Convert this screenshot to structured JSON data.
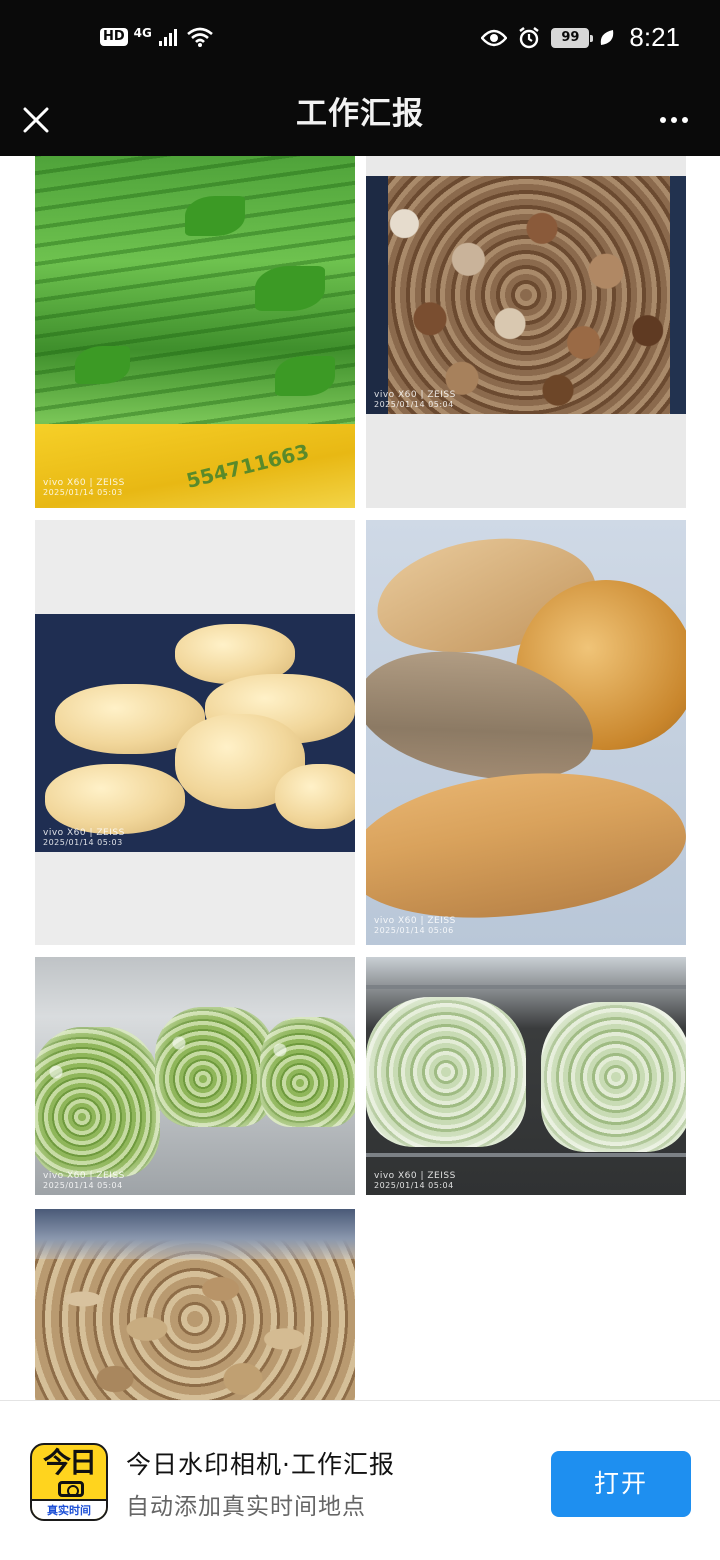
{
  "status_bar": {
    "hd_label": "HD",
    "network_label": "4G",
    "battery_level": "99",
    "time": "8:21"
  },
  "header": {
    "title": "工作汇报"
  },
  "photos": [
    {
      "name": "celery",
      "camera": "vivo X60 | ZEISS",
      "timestamp": "2025/01/14 05:03"
    },
    {
      "name": "mushrooms",
      "camera": "vivo X60 | ZEISS",
      "timestamp": "2025/01/14 05:04"
    },
    {
      "name": "lotus-root",
      "camera": "vivo X60 | ZEISS",
      "timestamp": "2025/01/14 05:03"
    },
    {
      "name": "pumpkins",
      "camera": "vivo X60 | ZEISS",
      "timestamp": "2025/01/14 05:06"
    },
    {
      "name": "beans-bags-1",
      "camera": "vivo X60 | ZEISS",
      "timestamp": "2025/01/14 05:04"
    },
    {
      "name": "beans-bags-2",
      "camera": "vivo X60 | ZEISS",
      "timestamp": "2025/01/14 05:04"
    },
    {
      "name": "ginger"
    }
  ],
  "celery_bag_text": "554711663",
  "banner": {
    "app_icon_text": "今日",
    "app_icon_strip": "真实时间",
    "app_name": "今日水印相机·工作汇报",
    "app_desc": "自动添加真实时间地点",
    "open_label": "打开",
    "accent_color": "#1e8ff0"
  }
}
